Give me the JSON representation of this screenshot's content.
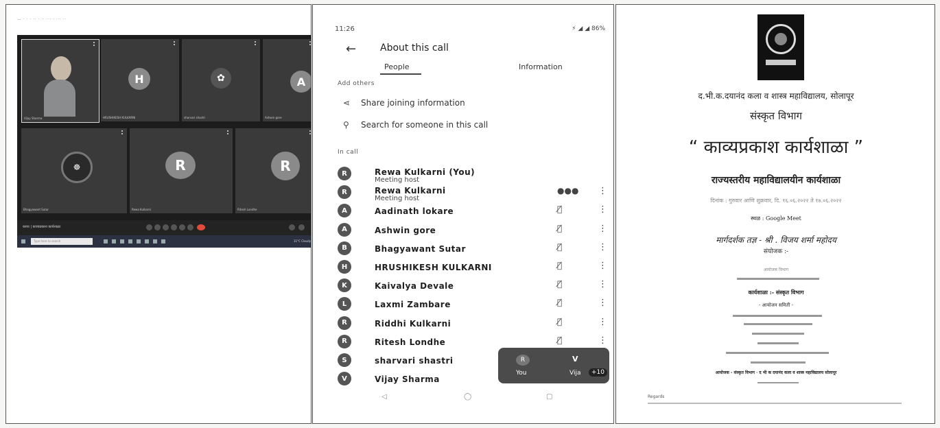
{
  "desktop": {
    "browser_text": "— · · ·  ·· · ·· ··· · ··· ··",
    "tiles": [
      {
        "kind": "video",
        "name": "Vijay Sharma"
      },
      {
        "kind": "avatar",
        "letter": "H",
        "name": "HRUSHIKESH KULKARNI"
      },
      {
        "kind": "image",
        "name": "sharvari shastri"
      },
      {
        "kind": "avatar",
        "letter": "A",
        "name": "Ashwin gore"
      },
      {
        "kind": "image",
        "name": "Bhagyawant Sutar"
      },
      {
        "kind": "avatar",
        "letter": "R",
        "name": "Rewa Kulkarni"
      },
      {
        "kind": "avatar",
        "letter": "R",
        "name": "Ritesh Londhe"
      }
    ],
    "call_name": "काव्य | काव्यप्रकाश कार्यशाळा",
    "taskbar_search": "Type here to search",
    "clock": "31°C Cloudy"
  },
  "phone": {
    "status_time": "11:26",
    "status_right": "⚡ ◢ ◢ 86%",
    "title": "About this call",
    "tabs": [
      "People",
      "Information"
    ],
    "add_others": "Add others",
    "share": "Share joining information",
    "search": "Search for someone in this call",
    "in_call": "In call",
    "participants": [
      {
        "initial": "R",
        "name": "Rewa Kulkarni (You)",
        "role": "Meeting host",
        "mic": ""
      },
      {
        "initial": "R",
        "name": "Rewa Kulkarni",
        "role": "Meeting host",
        "mic": "●●●"
      },
      {
        "initial": "A",
        "name": "Aadinath lokare",
        "role": "",
        "mic": "🎙̸"
      },
      {
        "initial": "A",
        "name": "Ashwin gore",
        "role": "",
        "mic": "🎙̸"
      },
      {
        "initial": "B",
        "name": "Bhagyawant Sutar",
        "role": "",
        "mic": "🎙̸"
      },
      {
        "initial": "H",
        "name": "HRUSHIKESH KULKARNI",
        "role": "",
        "mic": "🎙̸"
      },
      {
        "initial": "K",
        "name": "Kaivalya Devale",
        "role": "",
        "mic": "🎙̸"
      },
      {
        "initial": "L",
        "name": "Laxmi Zambare",
        "role": "",
        "mic": "🎙̸"
      },
      {
        "initial": "R",
        "name": "Riddhi Kulkarni",
        "role": "",
        "mic": "🎙̸"
      },
      {
        "initial": "R",
        "name": "Ritesh Londhe",
        "role": "",
        "mic": "🎙̸"
      },
      {
        "initial": "S",
        "name": "sharvari shastri",
        "role": "",
        "mic": ""
      },
      {
        "initial": "V",
        "name": "Vijay Sharma",
        "role": "",
        "mic": ""
      }
    ],
    "pip": {
      "you": "You",
      "v": "V",
      "vija": "Vija",
      "plus": "+10"
    }
  },
  "poster": {
    "college": "द.भी.क.दयानंद कला व शास्त्र महाविद्यालय, सोलापूर",
    "dept": "संस्कृत विभाग",
    "heading": "“ काव्यप्रकाश कार्यशाळा ”",
    "subheading": "राज्यस्तरीय महाविद्यालयीन कार्यशाळा",
    "dates": "दिनांक : गुरुवार आणि शुक्रवार, दि. १६.०६.२०२२ ते १७.०६.२०२२",
    "place": "स्थळ : Google Meet",
    "guide": "मार्गदर्शक तज्ञ - श्री . विजय शर्मा महोदय",
    "sanyojak": "संयोजक :-",
    "organizer": "आयोजक विभाग",
    "karyashala": "कार्यशाळा :-  संस्कृत विभाग",
    "samiti": "- आयोजन समिती -",
    "footer": "आयोजक - संस्कृत विभाग · द भी क दयानंद कला व शास्त्र महाविद्यालय सोलापूर",
    "regards": "Regards"
  }
}
